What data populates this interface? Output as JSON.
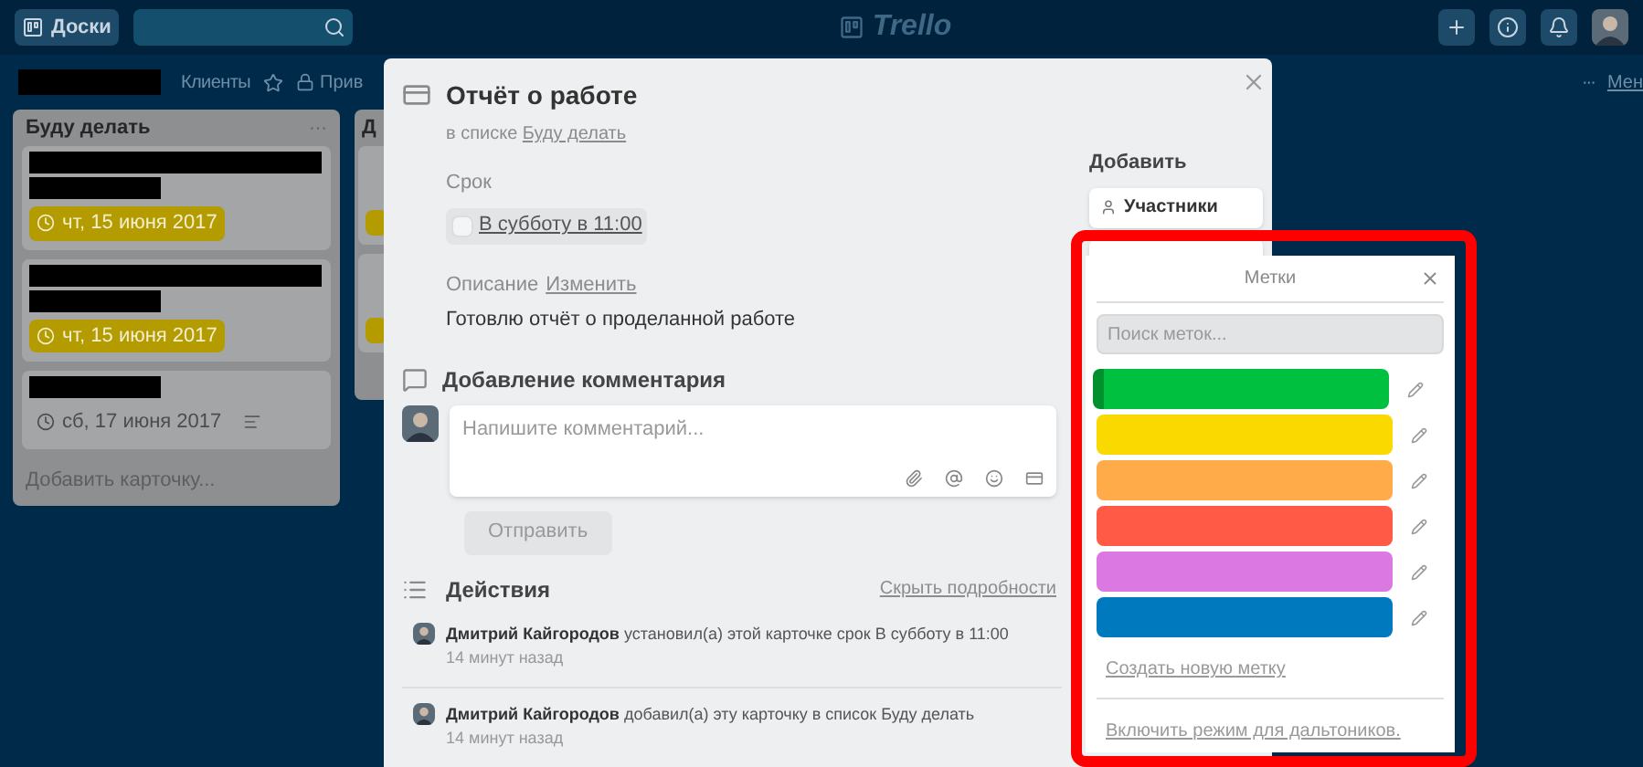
{
  "header": {
    "boards_button": "Доски",
    "logo": "Trello"
  },
  "board_header": {
    "items": [
      "Клиенты",
      "Прив"
    ],
    "more": "···",
    "menu": "Мен"
  },
  "lists": [
    {
      "title": "Буду делать",
      "menu": "···",
      "cards": [
        {
          "kind": "redacted_two_line",
          "badge": {
            "kind": "due_soon",
            "text": "чт, 15 июня 2017"
          },
          "has_description": false
        },
        {
          "kind": "redacted_two_line",
          "badge": {
            "kind": "due_soon",
            "text": "чт, 15 июня 2017"
          },
          "has_description": false
        },
        {
          "kind": "redacted_one_line",
          "badge": {
            "kind": "plain",
            "text": "сб, 17 июня 2017"
          },
          "has_description": true
        }
      ],
      "add_card": "Добавить карточку..."
    },
    {
      "title": "Д",
      "cards": [
        {
          "kind": "covered",
          "badge": {
            "kind": "due_soon_cut"
          }
        },
        {
          "kind": "covered",
          "badge": {
            "kind": "due_soon_cut"
          }
        }
      ]
    }
  ],
  "modal": {
    "title": "Отчёт о работе",
    "in_list_prefix": "в списке",
    "in_list_link": "Буду делать",
    "due_label": "Срок",
    "due_value": "В субботу в 11:00",
    "due_checked": false,
    "description_label": "Описание",
    "description_edit": "Изменить",
    "description": "Готовлю отчёт о проделанной работе",
    "comment_heading": "Добавление комментария",
    "comment_placeholder": "Напишите комментарий...",
    "send_button": "Отправить",
    "activity_heading": "Действия",
    "hide_details": "Скрыть подробности",
    "activities": [
      {
        "author": "Дмитрий Кайгородов",
        "text": "установил(а) этой карточке срок В субботу в 11:00",
        "time": "14 минут назад"
      },
      {
        "author": "Дмитрий Кайгородов",
        "text": "добавил(а) эту карточку в список Буду делать",
        "time": "14 минут назад"
      }
    ],
    "sidebar": {
      "heading": "Добавить",
      "buttons": [
        "Участники"
      ]
    }
  },
  "labels_popover": {
    "title": "Метки",
    "search_placeholder": "Поиск меток...",
    "highlighted": true,
    "labels": [
      {
        "color": "#00c040",
        "selected": true
      },
      {
        "color": "#f9d900",
        "selected": false
      },
      {
        "color": "#ffab4a",
        "selected": false
      },
      {
        "color": "#ff5a46",
        "selected": false
      },
      {
        "color": "#dc78e2",
        "selected": false
      },
      {
        "color": "#0079bf",
        "selected": false
      }
    ],
    "create_link": "Создать новую метку",
    "colorblind_link": "Включить режим для дальтоников."
  }
}
